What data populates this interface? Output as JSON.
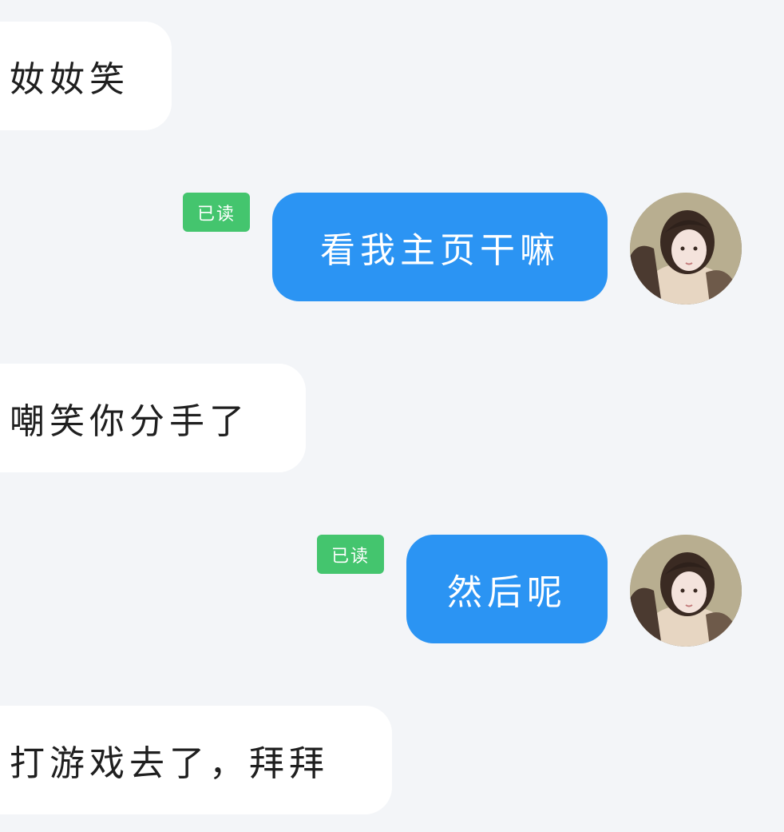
{
  "messages": [
    {
      "direction": "incoming",
      "text": "奻奻笑"
    },
    {
      "direction": "outgoing",
      "text": "看我主页干嘛",
      "read_status": "已读"
    },
    {
      "direction": "incoming",
      "text": "嘲笑你分手了"
    },
    {
      "direction": "outgoing",
      "text": "然后呢",
      "read_status": "已读"
    },
    {
      "direction": "incoming",
      "text": "打游戏去了，拜拜"
    }
  ],
  "colors": {
    "background": "#f3f5f8",
    "incoming_bubble": "#ffffff",
    "outgoing_bubble": "#2b94f3",
    "read_badge": "#44c56e"
  },
  "icons": {
    "avatar": "user-avatar-photo"
  }
}
